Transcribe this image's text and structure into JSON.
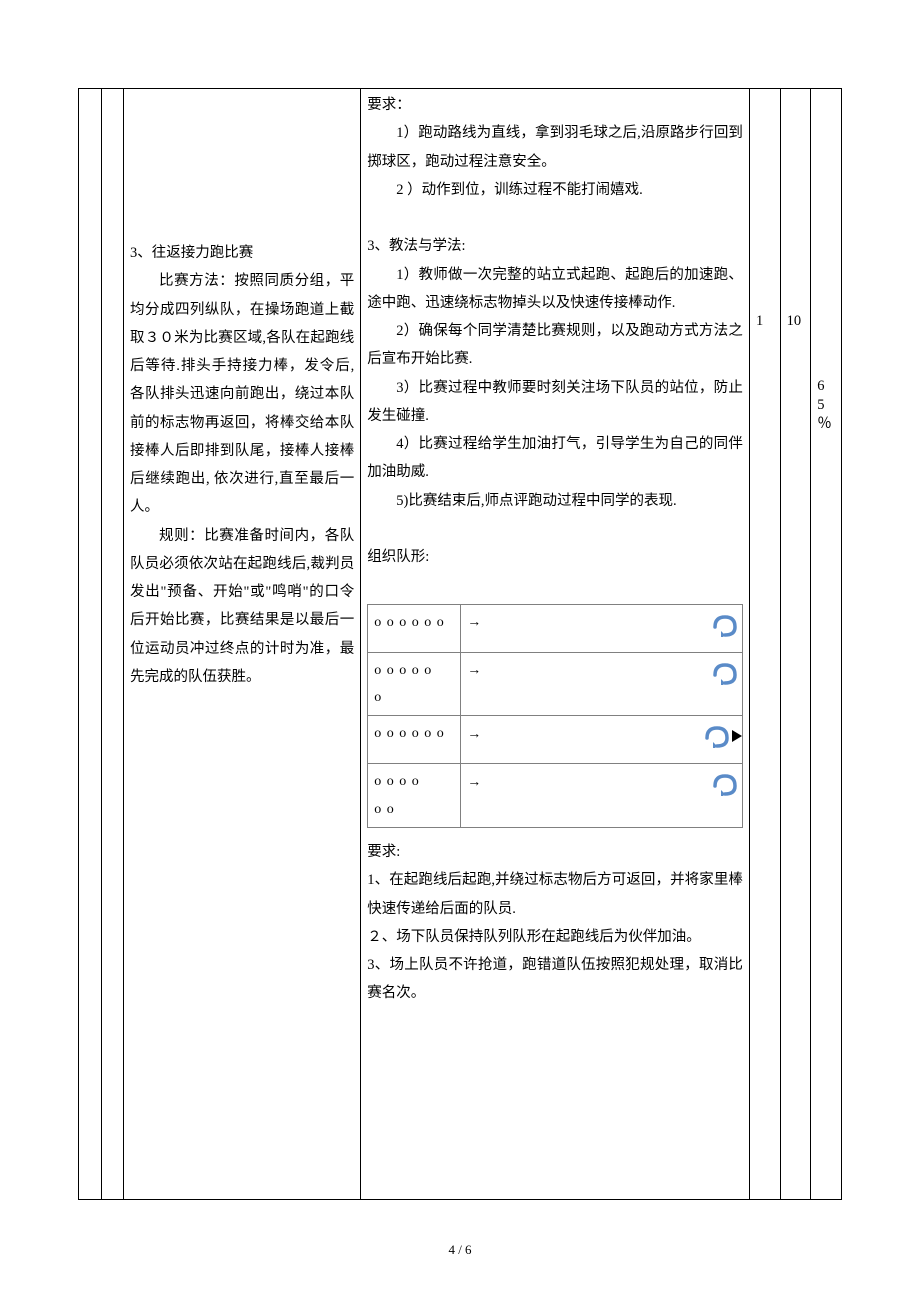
{
  "left": {
    "section3_title": "3、往返接力跑比赛",
    "section3_p1": "比赛方法：按照同质分组，平均分成四列纵队，在操场跑道上截取３０米为比赛区域,各队在起跑线后等待.排头手持接力棒，发令后,各队排头迅速向前跑出，绕过本队前的标志物再返回，将棒交给本队接棒人后即排到队尾，接棒人接棒后继续跑出, 依次进行,直至最后一人。",
    "section3_p2": "规则：比赛准备时间内，各队队员必须依次站在起跑线后,裁判员发出\"预备、开始\"或\"鸣哨\"的口令后开始比赛，比赛结果是以最后一位运动员冲过终点的计时为准，最先完成的队伍获胜。"
  },
  "right": {
    "req_label": "要求：",
    "req_1": "1）跑动路线为直线，拿到羽毛球之后,沿原路步行回到掷球区，跑动过程注意安全。",
    "req_2": "2 ）动作到位，训练过程不能打闹嬉戏.",
    "sec3_label": "3、教法与学法:",
    "s3_1": "1）教师做一次完整的站立式起跑、起跑后的加速跑、途中跑、迅速绕标志物掉头以及快速传接棒动作.",
    "s3_2": "2）确保每个同学清楚比赛规则，以及跑动方式方法之后宣布开始比赛.",
    "s3_3": "3）比赛过程中教师要时刻关注场下队员的站位，防止发生碰撞.",
    "s3_4": "4）比赛过程给学生加油打气，引导学生为自己的同伴加油助威.",
    "s3_5": "5)比赛结束后,师点评跑动过程中同学的表现.",
    "org_label": "组织队形:",
    "formation": [
      {
        "left": "o o o o o o",
        "extra": ""
      },
      {
        "left": "o o o o o",
        "extra": "o"
      },
      {
        "left": "o o o o o o",
        "extra": ""
      },
      {
        "left": "o o o o",
        "extra": "o o"
      }
    ],
    "req2_label": "要求:",
    "r2_1": "1、在起跑线后起跑,并绕过标志物后方可返回，并将家里棒快速传递给后面的队员.",
    "r2_2": "２、场下队员保持队列队形在起跑线后为伙伴加油。",
    "r2_3": "3、场上队员不许抢道，跑错道队伍按照犯规处理，取消比赛名次。"
  },
  "cols": {
    "d": "1",
    "e": "10",
    "f1": "6",
    "f2": "5",
    "f3": "％"
  },
  "pagenum": "4 / 6"
}
